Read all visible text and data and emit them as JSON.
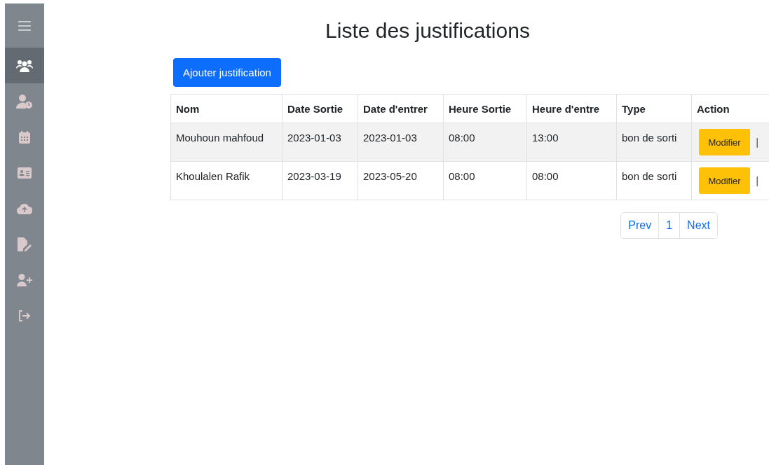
{
  "sidebar": {
    "items": [
      {
        "kind": "menu",
        "selected": false
      },
      {
        "kind": "users",
        "selected": true
      },
      {
        "kind": "user-clock",
        "selected": false
      },
      {
        "kind": "calendar",
        "selected": false
      },
      {
        "kind": "id-card",
        "selected": false
      },
      {
        "kind": "cloud-upload",
        "selected": false
      },
      {
        "kind": "file-pen",
        "selected": false
      },
      {
        "kind": "user-plus",
        "selected": false
      },
      {
        "kind": "logout",
        "selected": false
      }
    ]
  },
  "title": "Liste des justifications",
  "add_button": "Ajouter justification",
  "table": {
    "columns": [
      "Nom",
      "Date Sortie",
      "Date d'entrer",
      "Heure Sortie",
      "Heure d'entre",
      "Type",
      "Action"
    ],
    "rows": [
      {
        "cells": [
          "Mouhoun mahfoud",
          "2023-01-03",
          "2023-01-03",
          "08:00",
          "13:00",
          "bon de sorti"
        ],
        "action": "Modifier",
        "separator": "|"
      },
      {
        "cells": [
          "Khoulalen Rafik",
          "2023-03-19",
          "2023-05-20",
          "08:00",
          "08:00",
          "bon de sorti"
        ],
        "action": "Modifier",
        "separator": "|"
      }
    ]
  },
  "pagination": {
    "prev": "Prev",
    "pages": [
      "1"
    ],
    "next": "Next"
  }
}
